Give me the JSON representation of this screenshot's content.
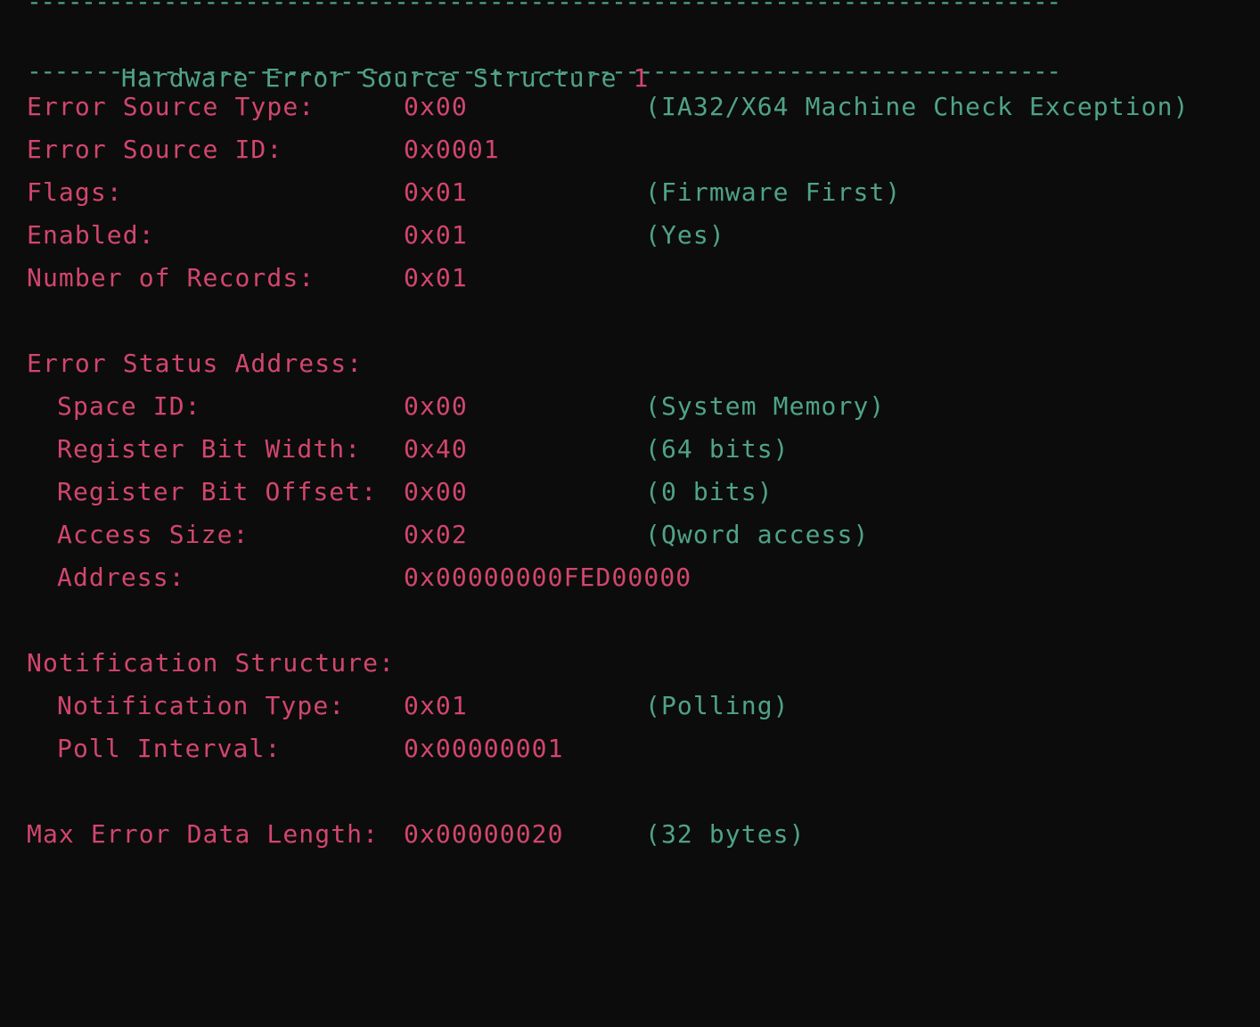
{
  "header": {
    "separator": "----------------------------------------------------------------------------",
    "title_text": "Hardware Error Source Structure",
    "title_number": "1"
  },
  "fields": [
    {
      "label": "Error Source Type:",
      "value": "0x00",
      "note": "(IA32/X64 Machine Check Exception)"
    },
    {
      "label": "Error Source ID:",
      "value": "0x0001",
      "note": ""
    },
    {
      "label": "Flags:",
      "value": "0x01",
      "note": "(Firmware First)"
    },
    {
      "label": "Enabled:",
      "value": "0x01",
      "note": "(Yes)"
    },
    {
      "label": "Number of Records:",
      "value": "0x01",
      "note": ""
    }
  ],
  "error_status_address": {
    "heading": "Error Status Address:",
    "fields": [
      {
        "label": "Space ID:",
        "value": "0x00",
        "note": "(System Memory)"
      },
      {
        "label": "Register Bit Width:",
        "value": "0x40",
        "note": "(64 bits)"
      },
      {
        "label": "Register Bit Offset:",
        "value": "0x00",
        "note": "(0 bits)"
      },
      {
        "label": "Access Size:",
        "value": "0x02",
        "note": "(Qword access)"
      },
      {
        "label": "Address:",
        "value": "0x00000000FED00000",
        "note": ""
      }
    ]
  },
  "notification_structure": {
    "heading": "Notification Structure:",
    "fields": [
      {
        "label": "Notification Type:",
        "value": "0x01",
        "note": "(Polling)"
      },
      {
        "label": "Poll Interval:",
        "value": "0x00000001",
        "note": ""
      }
    ]
  },
  "max_error_data_length": {
    "label": "Max Error Data Length:",
    "value": "0x00000020",
    "note": "(32 bytes)"
  },
  "colors": {
    "background": "#0c0c0c",
    "label": "#d2466e",
    "value": "#d2466e",
    "note": "#4fa387",
    "header": "#4fa387"
  }
}
